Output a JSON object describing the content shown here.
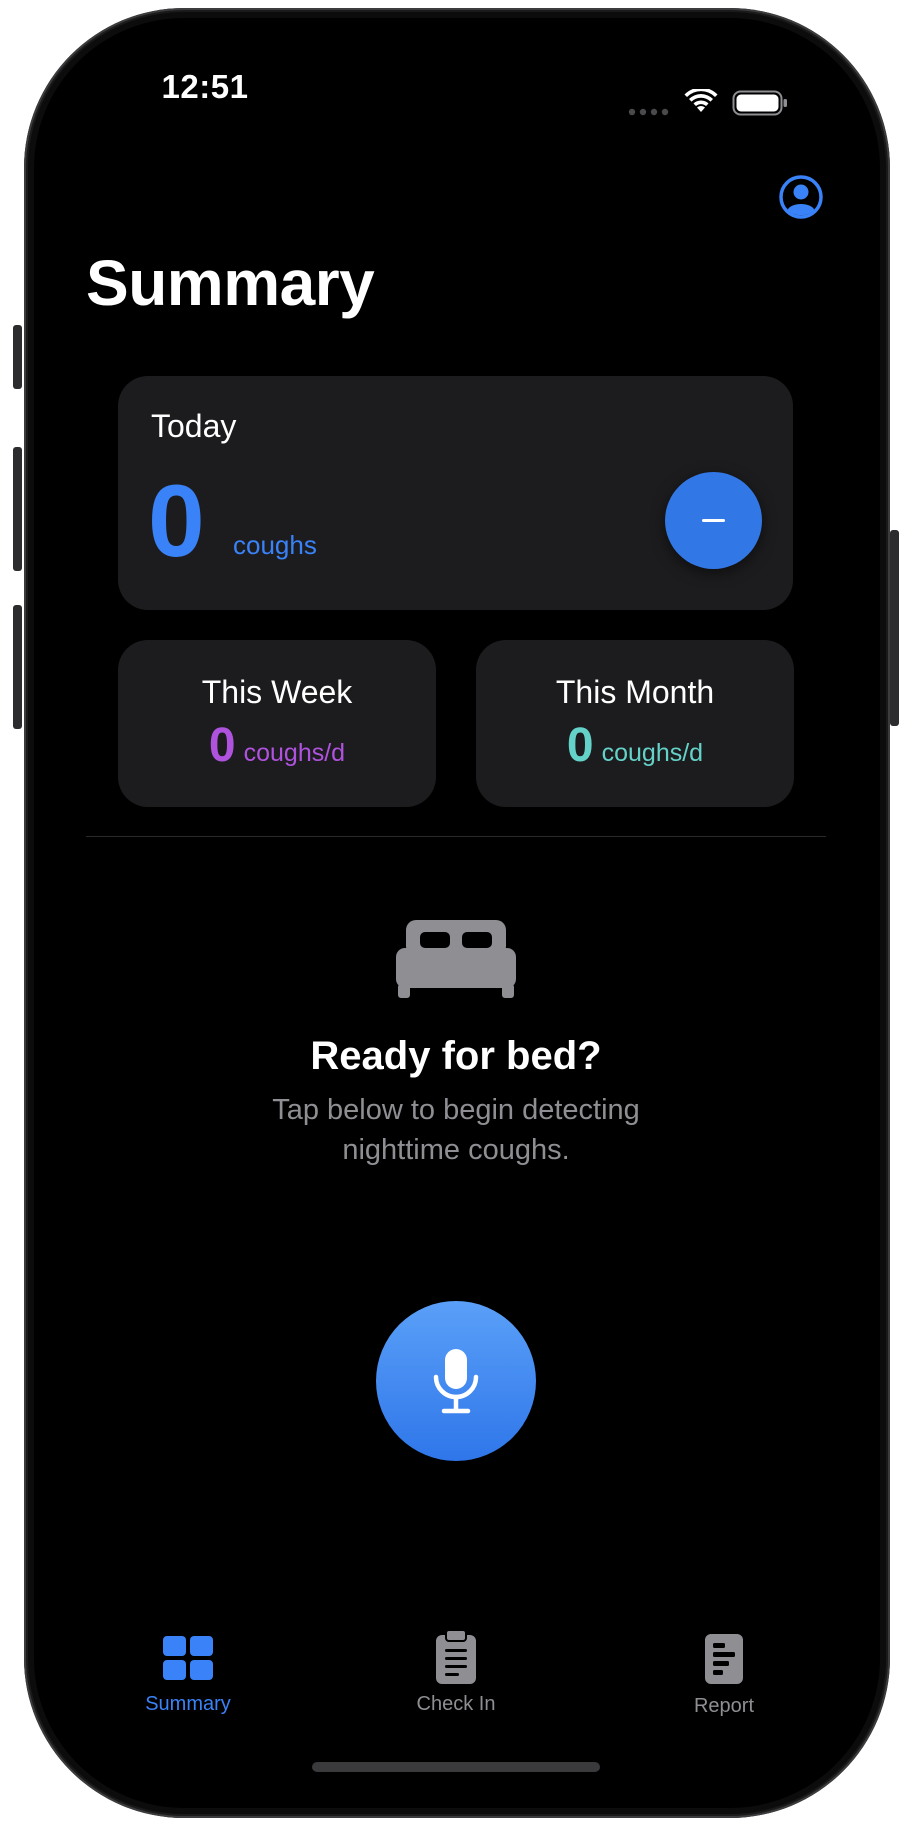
{
  "status_bar": {
    "time": "12:51",
    "icons": [
      "cellular-dots-icon",
      "wifi-icon",
      "battery-icon"
    ]
  },
  "header": {
    "profile_icon": "person-circle-icon",
    "title": "Summary"
  },
  "today_card": {
    "label": "Today",
    "count": "0",
    "unit": "coughs",
    "minus_label": "–"
  },
  "week_card": {
    "title": "This Week",
    "count": "0",
    "unit": "coughs/d",
    "color": "#af52de"
  },
  "month_card": {
    "title": "This Month",
    "count": "0",
    "unit": "coughs/d",
    "color": "#64d2c8"
  },
  "ready": {
    "icon": "bed-icon",
    "title": "Ready for bed?",
    "subtitle_line1": "Tap below to begin detecting",
    "subtitle_line2": "nighttime coughs."
  },
  "record_button": {
    "icon": "microphone-icon"
  },
  "tabs": [
    {
      "label": "Summary",
      "icon": "grid-icon",
      "active": true
    },
    {
      "label": "Check In",
      "icon": "clipboard-icon",
      "active": false
    },
    {
      "label": "Report",
      "icon": "report-icon",
      "active": false
    }
  ],
  "colors": {
    "accent": "#3a82f7",
    "inactive": "#8e8e93",
    "card": "#1c1c1e",
    "background": "#000000"
  }
}
